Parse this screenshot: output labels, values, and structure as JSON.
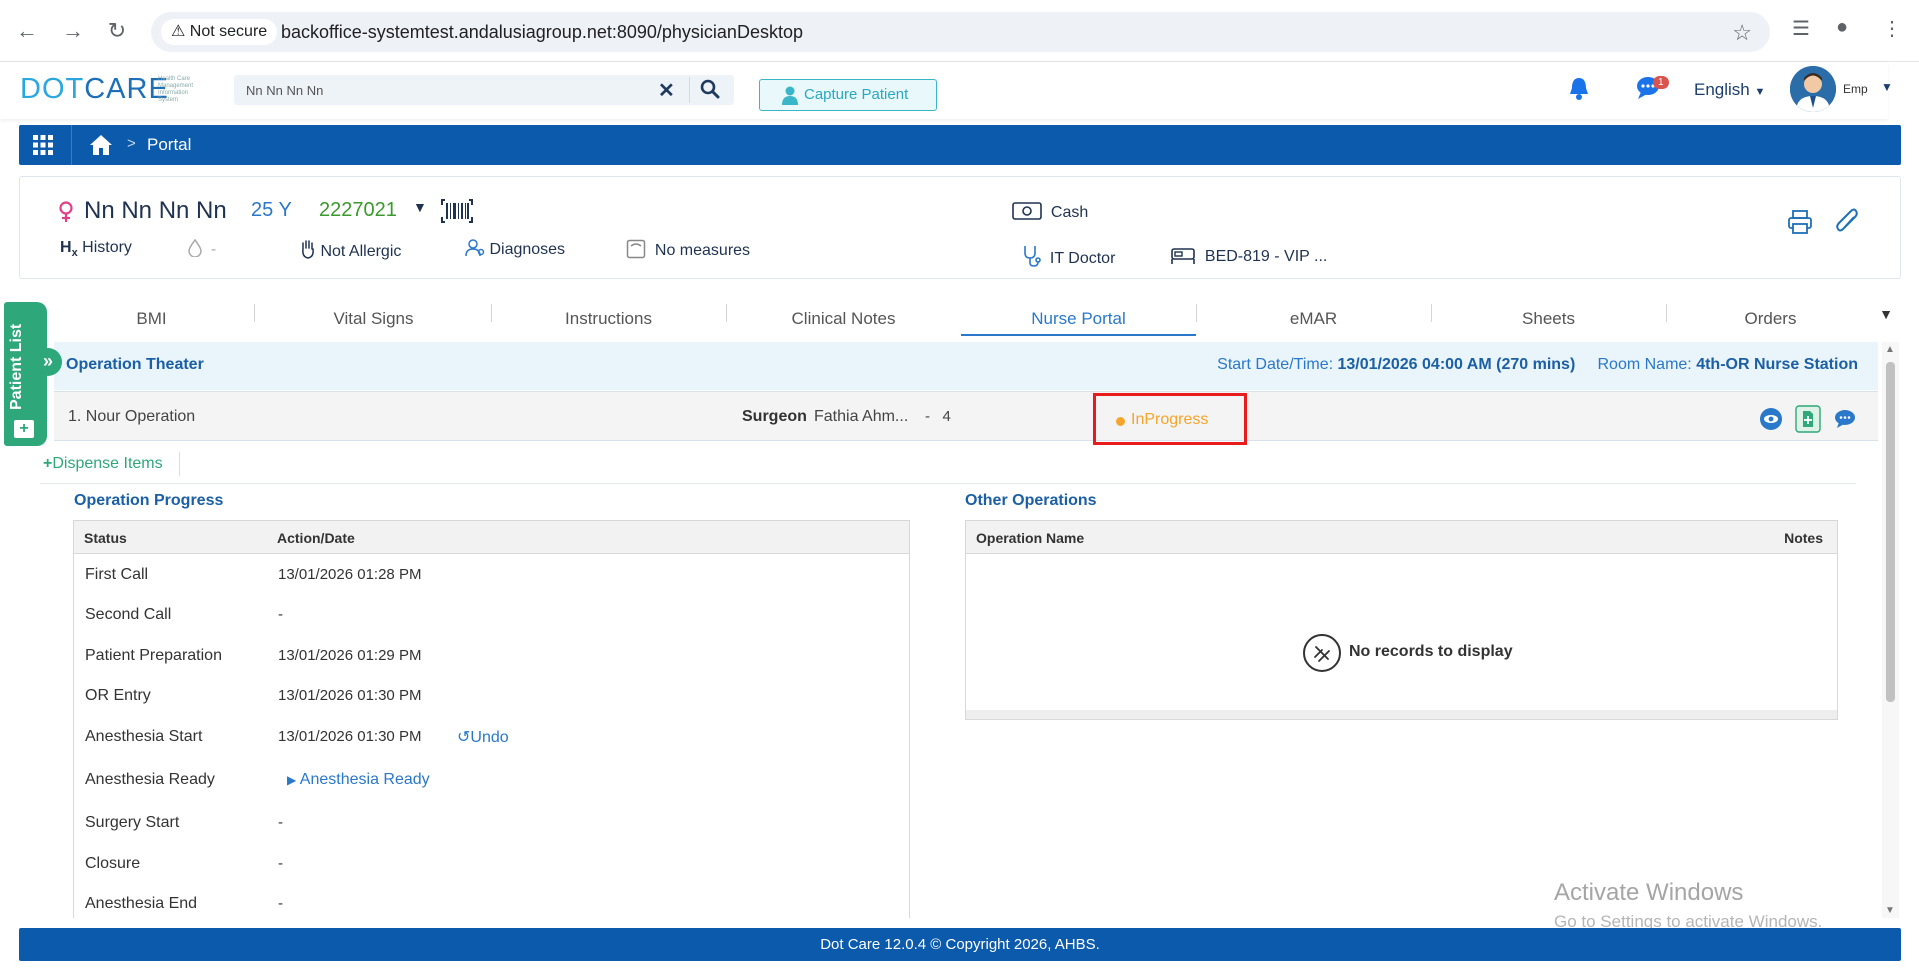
{
  "browser": {
    "secure_label": "Not secure",
    "url": "backoffice-systemtest.andalusiagroup.net:8090/physicianDesktop"
  },
  "header": {
    "logo_dot": "DOT",
    "logo_care": "CARE",
    "logo_tagline": "Health Care Management Information System",
    "search_value": "Nn Nn Nn Nn",
    "capture_label": "Capture Patient",
    "notification_badge": "1",
    "language": "English",
    "user": "Emp"
  },
  "breadcrumb": {
    "separator": ">",
    "current": "Portal"
  },
  "patient": {
    "name": "Nn Nn Nn Nn",
    "age": "25 Y",
    "mrn": "2227021",
    "history_label": "History",
    "blood_type": "-",
    "allergy": "Not Allergic",
    "diagnoses": "Diagnoses",
    "measures": "No measures",
    "payer": "Cash",
    "doctor": "IT Doctor",
    "bed": "BED-819 - VIP ..."
  },
  "tabs": [
    "BMI",
    "Vital Signs",
    "Instructions",
    "Clinical Notes",
    "Nurse Portal",
    "eMAR",
    "Sheets",
    "Orders"
  ],
  "side_tab": {
    "label": "Patient List"
  },
  "operation": {
    "section_title": "Operation Theater",
    "start_label": "Start Date/Time:",
    "start_value": "13/01/2026 04:00 AM (270 mins)",
    "room_label": "Room Name:",
    "room_value": "4th-OR Nurse Station",
    "name": "1. Nour Operation",
    "surgeon_label": "Surgeon",
    "surgeon_value": "Fathia Ahm...",
    "dash": "-",
    "number": "4",
    "status": "InProgress",
    "dispense_label": "Dispense Items"
  },
  "progress": {
    "title": "Operation Progress",
    "col_status": "Status",
    "col_action": "Action/Date",
    "rows": [
      {
        "status": "First Call",
        "value": "13/01/2026 01:28 PM"
      },
      {
        "status": "Second Call",
        "value": "-"
      },
      {
        "status": "Patient Preparation",
        "value": "13/01/2026 01:29 PM"
      },
      {
        "status": "OR Entry",
        "value": "13/01/2026 01:30 PM"
      },
      {
        "status": "Anesthesia Start",
        "value": "13/01/2026 01:30 PM",
        "extra": "Undo"
      },
      {
        "status": "Anesthesia Ready",
        "action": "Anesthesia Ready"
      },
      {
        "status": "Surgery Start",
        "value": "-"
      },
      {
        "status": "Closure",
        "value": "-"
      },
      {
        "status": "Anesthesia End",
        "value": "-"
      }
    ]
  },
  "other_operations": {
    "title": "Other Operations",
    "col_name": "Operation Name",
    "col_notes": "Notes",
    "empty": "No records to display"
  },
  "watermark": {
    "line1": "Activate Windows",
    "line2": "Go to Settings to activate Windows."
  },
  "footer": "Dot Care 12.0.4 © Copyright 2026, AHBS.",
  "colors": {
    "primary": "#0b5aab",
    "accent_green": "#2ea77a",
    "status_orange": "#f5a52b",
    "highlight_red": "#e81c1c"
  }
}
